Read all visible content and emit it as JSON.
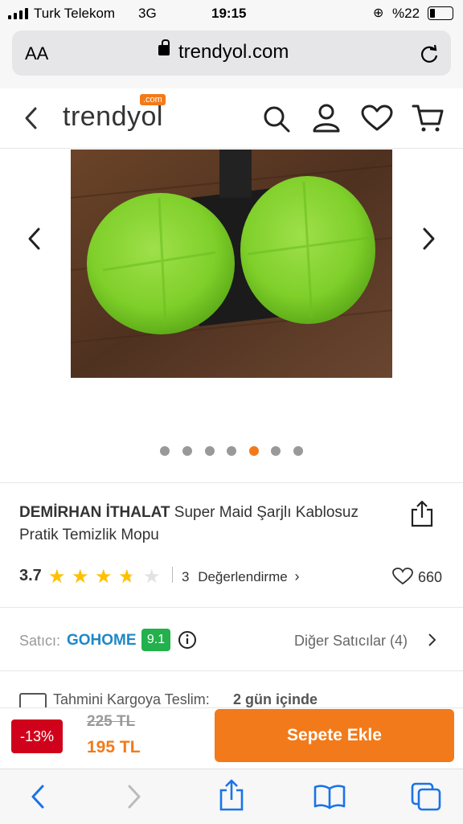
{
  "status": {
    "carrier": "Turk Telekom",
    "network": "3G",
    "time": "19:15",
    "battery": "%22"
  },
  "browser": {
    "text_size": "AA",
    "url": "trendyol.com"
  },
  "header": {
    "logo": "trendyol",
    "logo_badge": ".com"
  },
  "gallery": {
    "dots_total": 7,
    "active_dot": 5,
    "accent": "#f27a1a"
  },
  "product": {
    "brand": "DEMİRHAN İTHALAT",
    "name": "Super Maid Şarjlı Kablosuz Pratik Temizlik Mopu",
    "rating": "3.7",
    "rating_value": 3.7,
    "review_count": "3",
    "review_label": "Değerlendirme",
    "favorites": "660"
  },
  "seller": {
    "label": "Satıcı:",
    "name": "GOHOME",
    "score": "9.1",
    "other_sellers": "Diğer Satıcılar (4)"
  },
  "shipping": {
    "label": "Tahmini Kargoya Teslim:",
    "value": "2 gün içinde"
  },
  "buy": {
    "discount": "-13%",
    "old_price": "225 TL",
    "price": "195 TL",
    "add_to_cart": "Sepete Ekle"
  }
}
